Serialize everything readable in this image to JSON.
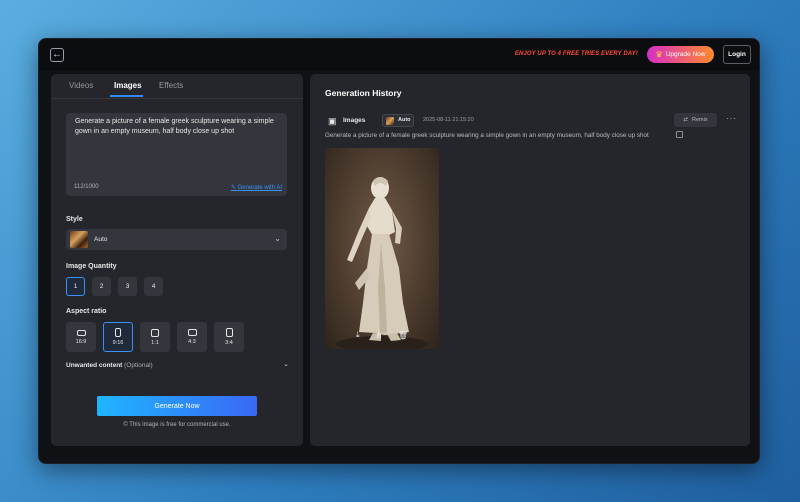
{
  "topbar": {
    "back_icon": "arrow-left-icon",
    "promo": "ENJOY UP TO 4 FREE TRIES EVERY DAY!",
    "upgrade_label": "Upgrade Now",
    "login_label": "Login"
  },
  "left": {
    "tabs": [
      {
        "label": "Videos"
      },
      {
        "label": "Images"
      },
      {
        "label": "Effects"
      }
    ],
    "prompt": {
      "value": "Generate a picture of a female greek sculpture wearing a simple gown in an empty museum, half body close up shot",
      "count": "112/1000",
      "generate_ai": "Generate with AI"
    },
    "style": {
      "label": "Style",
      "value": "Auto"
    },
    "quantity": {
      "label": "Image Quantity",
      "options": [
        "1",
        "2",
        "3",
        "4"
      ],
      "selected": "1"
    },
    "aspect": {
      "label": "Aspect ratio",
      "options": [
        "16:9",
        "9:16",
        "1:1",
        "4:3",
        "3:4"
      ],
      "selected": "9:16"
    },
    "unwanted": {
      "label": "Unwanted content",
      "optional": "(Optional)"
    },
    "generate_button": "Generate Now",
    "free_note": "This image is free for commercial use."
  },
  "right": {
    "title": "Generation History",
    "entry": {
      "type_label": "Images",
      "style_badge": "Auto",
      "datetime": "2025-08-11 21:15:20",
      "remix_label": "Remix",
      "prompt": "Generate a picture of a female greek sculpture wearing a simple gown in an empty museum, half body close up shot"
    }
  },
  "colors": {
    "accent": "#3c8ff5",
    "promo": "#ff4a3a",
    "panel": "#24262b",
    "frame": "#101114"
  }
}
